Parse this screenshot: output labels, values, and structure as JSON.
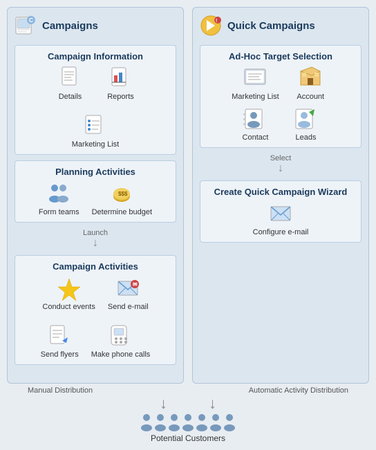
{
  "left_panel": {
    "title": "Campaigns",
    "campaign_info": {
      "title": "Campaign Information",
      "items": [
        {
          "label": "Details",
          "icon": "details"
        },
        {
          "label": "Reports",
          "icon": "reports"
        },
        {
          "label": "Marketing List",
          "icon": "marketing-list"
        }
      ]
    },
    "planning": {
      "title": "Planning Activities",
      "items": [
        {
          "label": "Form teams",
          "icon": "form-teams"
        },
        {
          "label": "Determine budget",
          "icon": "determine-budget"
        }
      ]
    },
    "launch_label": "Launch",
    "campaign_activities": {
      "title": "Campaign Activities",
      "items": [
        {
          "label": "Conduct events",
          "icon": "conduct-events"
        },
        {
          "label": "Send e-mail",
          "icon": "send-email"
        },
        {
          "label": "Send flyers",
          "icon": "send-flyers"
        },
        {
          "label": "Make phone calls",
          "icon": "make-phone-calls"
        }
      ]
    }
  },
  "right_panel": {
    "title": "Quick Campaigns",
    "adhoc": {
      "title": "Ad-Hoc Target Selection",
      "items": [
        {
          "label": "Marketing List",
          "icon": "marketing-list"
        },
        {
          "label": "Account",
          "icon": "account"
        },
        {
          "label": "Contact",
          "icon": "contact"
        },
        {
          "label": "Leads",
          "icon": "leads"
        }
      ]
    },
    "select_label": "Select",
    "wizard": {
      "title": "Create Quick Campaign Wizard",
      "items": [
        {
          "label": "Configure e-mail",
          "icon": "configure-email"
        }
      ]
    }
  },
  "bottom": {
    "manual_label": "Manual Distribution",
    "auto_label": "Automatic Activity Distribution",
    "customers_label": "Potential Customers"
  }
}
